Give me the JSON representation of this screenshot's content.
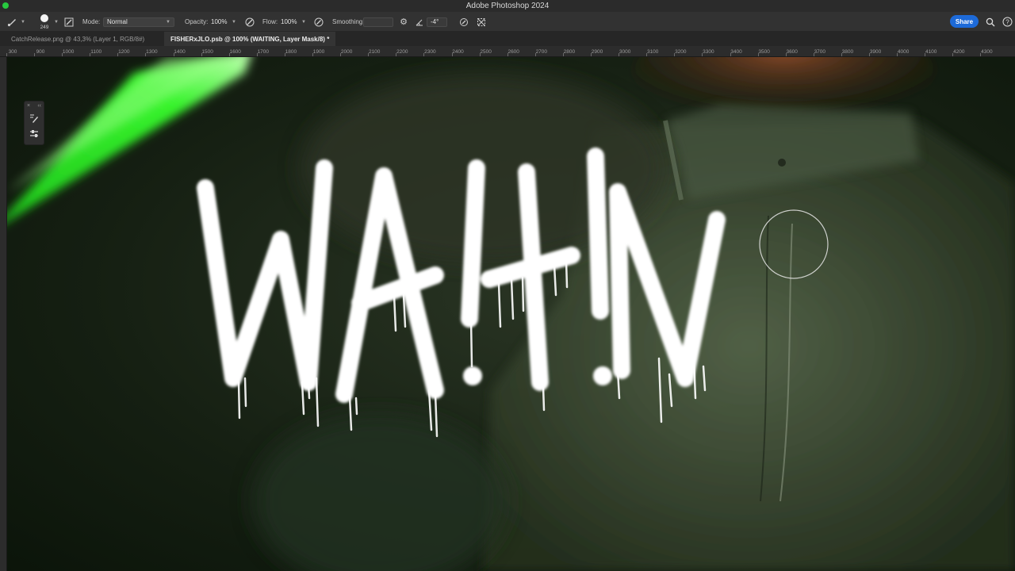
{
  "app": {
    "title": "Adobe Photoshop 2024"
  },
  "options_bar": {
    "brush_size": "249",
    "mode_label": "Mode:",
    "mode_value": "Normal",
    "opacity_label": "Opacity:",
    "opacity_value": "100%",
    "flow_label": "Flow:",
    "flow_value": "100%",
    "smoothing_label": "Smoothing:",
    "smoothing_value": "",
    "angle_value": "-4°",
    "share_label": "Share",
    "icons": [
      "brush-tool-icon",
      "brush-preset-icon",
      "brush-settings-toggle-icon",
      "pressure-opacity-icon",
      "airbrush-icon",
      "smoothing-gear-icon",
      "angle-icon",
      "pressure-size-icon",
      "symmetry-icon",
      "search-icon",
      "help-icon"
    ]
  },
  "tabs": [
    {
      "label": "CatchRelease.png @ 43,3% (Layer 1, RGB/8#)",
      "active": false
    },
    {
      "label": "FISHERxJLO.psb @ 100% (WAITING, Layer Mask/8) *",
      "active": true
    }
  ],
  "ruler": {
    "top_labels": [
      "300",
      "900",
      "1000",
      "1100",
      "1200",
      "1300",
      "1400",
      "1500",
      "1600",
      "1700",
      "1800",
      "1900",
      "2000",
      "2100",
      "2200",
      "2300",
      "2400",
      "2500",
      "2600",
      "2700",
      "2800",
      "2900",
      "3000",
      "3100",
      "3200",
      "3300",
      "3400",
      "3500",
      "3600",
      "3700",
      "3800",
      "3900",
      "4000",
      "4100",
      "4200",
      "4300"
    ]
  },
  "canvas": {
    "artwork_text": "WA!t!N",
    "colors": {
      "green_light": "#39ff2e",
      "background": "#0f1a0d",
      "paint": "#ffffff"
    }
  },
  "tool_panel": {
    "icons": [
      "brush-preset-icon",
      "brush-adjust-icon"
    ]
  }
}
